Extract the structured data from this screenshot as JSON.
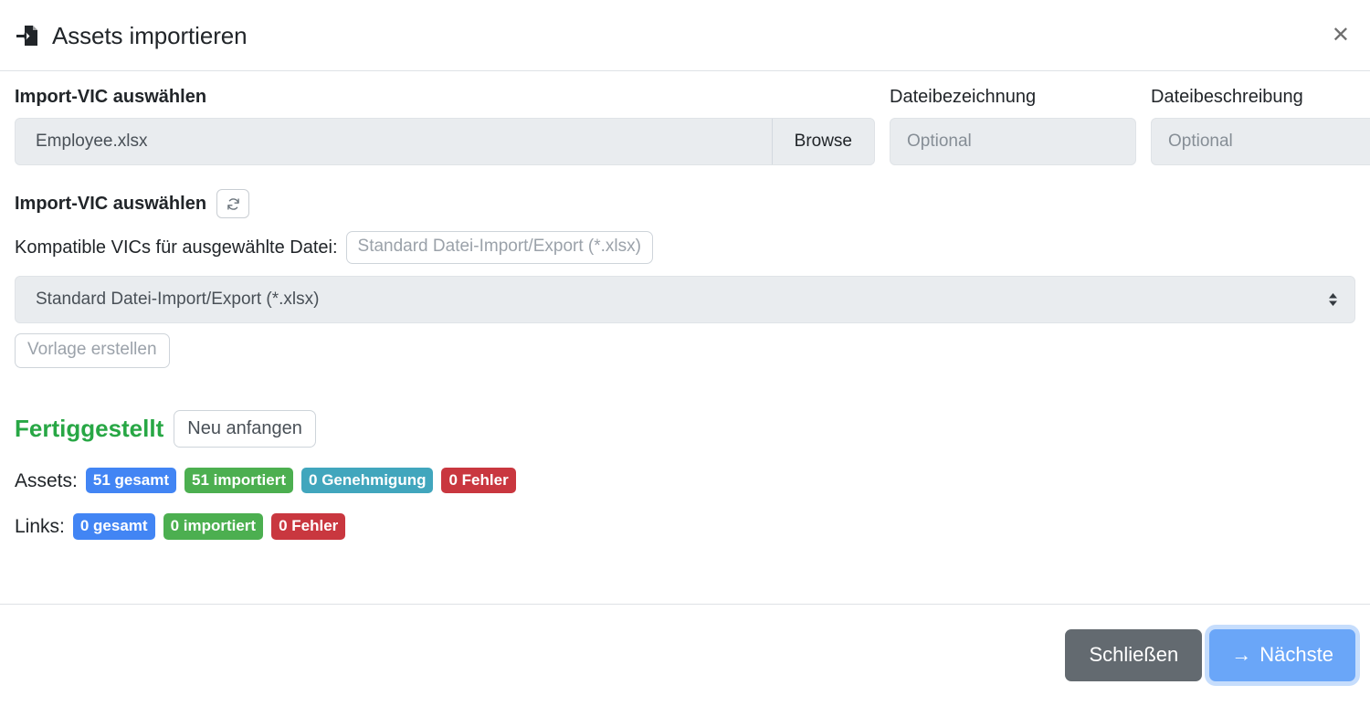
{
  "header": {
    "title": "Assets importieren",
    "icon": "file-import-icon",
    "close_label": "✕"
  },
  "file_section": {
    "label": "Import-VIC auswählen",
    "filename": "Employee.xlsx",
    "browse_label": "Browse",
    "name_label": "Dateibezeichnung",
    "name_placeholder": "Optional",
    "name_value": "",
    "desc_label": "Dateibeschreibung",
    "desc_placeholder": "Optional",
    "desc_value": ""
  },
  "vic_section": {
    "label": "Import-VIC auswählen",
    "refresh_icon": "refresh-icon",
    "compatible_label": "Kompatible VICs für ausgewählte Datei:",
    "compatible_value": "Standard Datei-Import/Export (*.xlsx)",
    "selected_vic": "Standard Datei-Import/Export (*.xlsx)",
    "vic_options": [
      "Standard Datei-Import/Export (*.xlsx)"
    ],
    "create_template_label": "Vorlage erstellen"
  },
  "status": {
    "state_text": "Fertiggestellt",
    "state_color": "#28a745",
    "restart_label": "Neu anfangen",
    "assets": {
      "label": "Assets:",
      "badges": [
        {
          "text": "51 gesamt",
          "color": "#4285f4",
          "style": "primary"
        },
        {
          "text": "51 importiert",
          "color": "#4caf50",
          "style": "success"
        },
        {
          "text": "0 Genehmigung",
          "color": "#41a6bd",
          "style": "info"
        },
        {
          "text": "0 Fehler",
          "color": "#c9373f",
          "style": "danger"
        }
      ]
    },
    "links": {
      "label": "Links:",
      "badges": [
        {
          "text": "0 gesamt",
          "color": "#4285f4",
          "style": "primary"
        },
        {
          "text": "0 importiert",
          "color": "#4caf50",
          "style": "success"
        },
        {
          "text": "0 Fehler",
          "color": "#c9373f",
          "style": "danger"
        }
      ]
    }
  },
  "footer": {
    "close_label": "Schließen",
    "next_arrow": "→",
    "next_label": "Nächste"
  }
}
